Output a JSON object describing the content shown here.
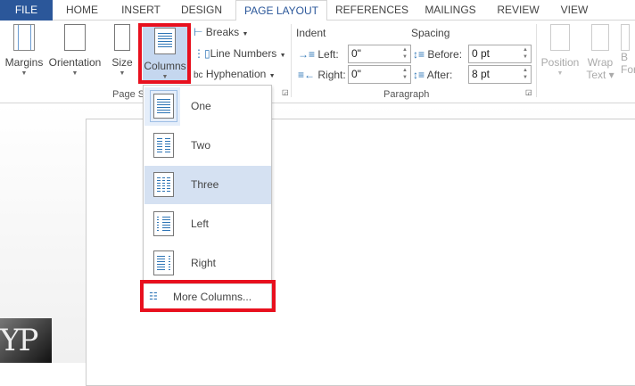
{
  "tabs": [
    "FILE",
    "HOME",
    "INSERT",
    "DESIGN",
    "PAGE LAYOUT",
    "REFERENCES",
    "MAILINGS",
    "REVIEW",
    "VIEW"
  ],
  "active_tab": "PAGE LAYOUT",
  "page_setup": {
    "margins": "Margins",
    "orientation": "Orientation",
    "size": "Size",
    "columns": "Columns",
    "breaks": "Breaks",
    "line_numbers": "Line Numbers",
    "hyphenation": "Hyphenation",
    "group_label": "Page S"
  },
  "paragraph": {
    "indent": "Indent",
    "spacing": "Spacing",
    "left_label": "Left:",
    "left_value": "0\"",
    "right_label": "Right:",
    "right_value": "0\"",
    "before_label": "Before:",
    "before_value": "0 pt",
    "after_label": "After:",
    "after_value": "8 pt",
    "group_label": "Paragraph"
  },
  "arrange": {
    "position": "Position",
    "wrap": "Wrap",
    "wrap2": "Text",
    "bring": "B",
    "bring2": "For"
  },
  "columns_menu": {
    "items": [
      "One",
      "Two",
      "Three",
      "Left",
      "Right"
    ],
    "more": "More Columns...",
    "selected": "One",
    "hovered": "Three"
  },
  "highlight_color": "#e8101e",
  "logo": "YP"
}
